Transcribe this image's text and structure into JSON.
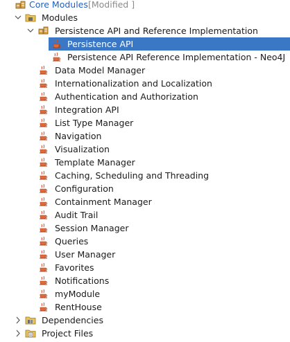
{
  "root": {
    "label": "Core Modules",
    "suffix": "[Modified ]"
  },
  "modules_folder": {
    "label": "Modules"
  },
  "persistence_group": {
    "label": "Persistence API and Reference Implementation"
  },
  "persistence_children": [
    {
      "label": "Persistence API",
      "selected": true
    },
    {
      "label": "Persistence API Reference Implementation - Neo4J",
      "selected": false
    }
  ],
  "modules": [
    "Data Model Manager",
    "Internationalization and Localization",
    "Authentication and Authorization",
    "Integration API",
    "List Type Manager",
    "Navigation",
    "Visualization",
    "Template Manager",
    "Caching, Scheduling and Threading",
    "Configuration",
    "Containment Manager",
    "Audit Trail",
    "Session Manager",
    "Queries",
    "User Manager",
    "Favorites",
    "Notifications",
    "myModule",
    "RentHouse"
  ],
  "dependencies": {
    "label": "Dependencies"
  },
  "project_files": {
    "label": "Project Files"
  },
  "colors": {
    "selection": "#3a78c6",
    "root_text": "#1f5fbf",
    "suffix_text": "#8a8a8a"
  }
}
